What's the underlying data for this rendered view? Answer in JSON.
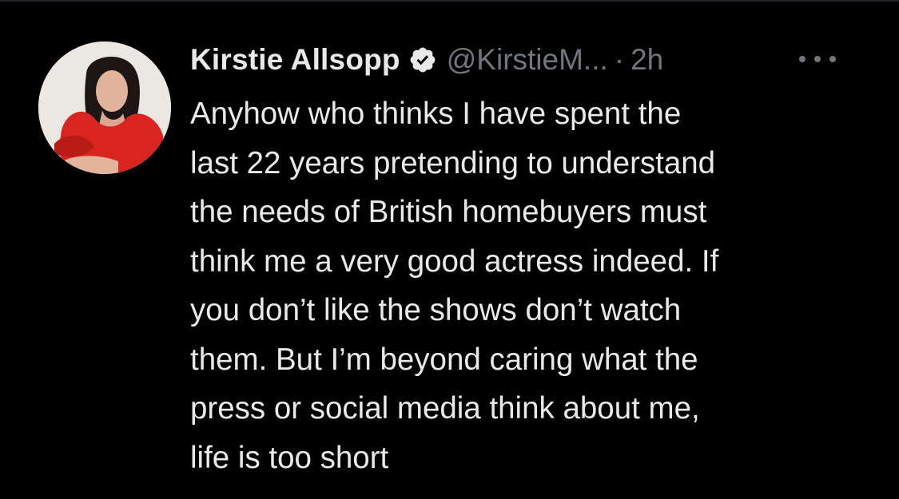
{
  "tweet": {
    "author": {
      "display_name": "Kirstie Allsopp",
      "verified_icon": "verified-badge-icon",
      "handle": "@KirstieM...",
      "separator": "·",
      "timestamp": "2h"
    },
    "more_icon": "more-options-icon",
    "text": "Anyhow who thinks I have spent the\nlast 22 years pretending to understand\nthe needs of British homebuyers must\nthink me a very good actress indeed. If\nyou don’t like the shows don’t watch\nthem. But I’m beyond caring what the\npress or social media think about me,\nlife is too short"
  },
  "colors": {
    "background": "#000000",
    "primary_text": "#e7e9ea",
    "secondary_text": "#71767b",
    "verified_badge": "#e7e9ea"
  }
}
